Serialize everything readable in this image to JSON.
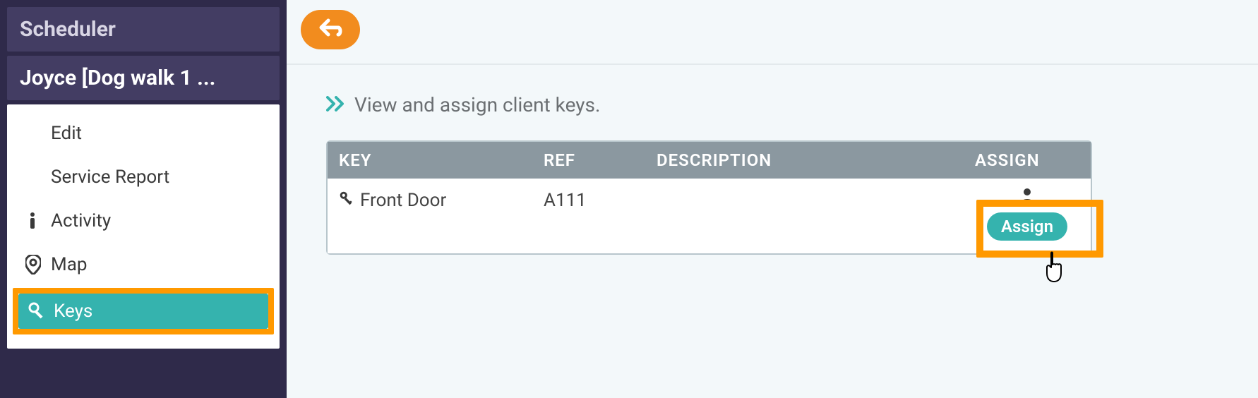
{
  "sidebar": {
    "header1": "Scheduler",
    "header2": "Joyce [Dog walk 1 ...",
    "items": [
      {
        "label": "Edit"
      },
      {
        "label": "Service Report"
      },
      {
        "label": "Activity"
      },
      {
        "label": "Map"
      },
      {
        "label": "Keys"
      }
    ]
  },
  "page": {
    "subtitle": "View and assign client keys."
  },
  "table": {
    "headers": {
      "key": "KEY",
      "ref": "REF",
      "desc": "DESCRIPTION",
      "assign": "ASSIGN"
    },
    "rows": [
      {
        "key": "Front Door",
        "ref": "A111",
        "desc": "",
        "assign_label": "Assign"
      }
    ]
  }
}
